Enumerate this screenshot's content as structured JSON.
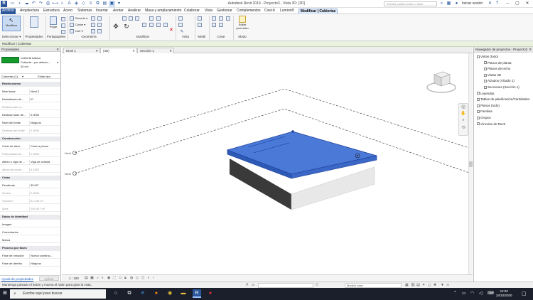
{
  "app": {
    "title": "Autodesk Revit 2019 - Proyecto3 - Vista 3D: {3D}",
    "search_placeholder": "Escriba palabra clave o frase",
    "sign_in": "Iniciar sesión"
  },
  "menu": {
    "items": [
      "Archivo",
      "Arquitectura",
      "Estructura",
      "Acero",
      "Sistemas",
      "Insertar",
      "Anotar",
      "Analizar",
      "Masa y emplazamiento",
      "Colaborar",
      "Vista",
      "Gestionar",
      "Complementos",
      "Cost-It",
      "Lumion®",
      "Modificar | Cubiertas"
    ]
  },
  "ribbon": {
    "modify_label": "Modificar",
    "select_label": "Seleccionar ▾",
    "properties_label": "Propiedades",
    "clipboard_label": "Portapapeles",
    "paste_label": "Pegar",
    "cope_label": "Recorte ▾",
    "cut_label": "Cortar ▾",
    "join_label": "Unir ▾",
    "geometry_label": "Geometría",
    "modify_panel_label": "Modificar",
    "view_label": "Vista",
    "measure_label": "Medir",
    "create_label": "Crear",
    "edit_perimeter_label": "Editar perímetro",
    "mode_label": "Modo"
  },
  "context_bar": "Modificar | Cubiertas",
  "properties": {
    "header": "Propiedades",
    "type_name_1": "Cubierta básica",
    "type_name_2": "Cubierta - por defecto -",
    "type_name_3": "30 cm",
    "selection": "Cubiertas (1)",
    "edit_type": "Editar tipo",
    "rows": [
      {
        "k": "Restricciones",
        "v": "",
        "group": true
      },
      {
        "k": "Nivel base",
        "v": "Nivel 2"
      },
      {
        "k": "Delimitación de...",
        "v": "☑"
      },
      {
        "k": "Relacionado co...",
        "v": "",
        "dim": true
      },
      {
        "k": "Desfase base de...",
        "v": "0.0000"
      },
      {
        "k": "Nivel del límite",
        "v": "Ninguno"
      },
      {
        "k": "Desfase del límite",
        "v": "0.0000",
        "dim": true
      },
      {
        "k": "Construcción",
        "v": "",
        "group": true
      },
      {
        "k": "Corte de alero",
        "v": "Corte a plomo"
      },
      {
        "k": "Profundidad de...",
        "v": "0.0000",
        "dim": true
      },
      {
        "k": "Altero o vigo de ...",
        "v": "Viga de celosía"
      },
      {
        "k": "Altura de comb...",
        "v": "6.4352",
        "dim": true
      },
      {
        "k": "Cotas",
        "v": "",
        "group": true
      },
      {
        "k": "Pendiente",
        "v": "30.00°"
      },
      {
        "k": "Grosor",
        "v": "0.3000",
        "dim": true
      },
      {
        "k": "Volumen",
        "v": "61.249 m³",
        "dim": true
      },
      {
        "k": "Área",
        "v": "204.497 m²",
        "dim": true
      },
      {
        "k": "Datos de identidad",
        "v": "",
        "group": true
      },
      {
        "k": "Imagen",
        "v": ""
      },
      {
        "k": "Comentarios",
        "v": ""
      },
      {
        "k": "Marca",
        "v": ""
      },
      {
        "k": "Proceso por fases",
        "v": "",
        "group": true
      },
      {
        "k": "Fase de creación",
        "v": "Nueva construc..."
      },
      {
        "k": "Fase de derribo",
        "v": "Ninguno"
      }
    ],
    "help_link": "Ayuda de propiedades",
    "apply": "Aplicar"
  },
  "tabs": [
    "Nivel 1",
    "{3D}",
    "Sección 1"
  ],
  "view": {
    "scale": "1 : 100",
    "level_tag": "Nivel"
  },
  "browser": {
    "header": "Navegador de proyectos - Proyecto3",
    "items": [
      {
        "t": "Vistas (todo)",
        "indent": 0
      },
      {
        "t": "Planos de planta",
        "indent": 1
      },
      {
        "t": "Planos de techo",
        "indent": 1
      },
      {
        "t": "Vistas 3D",
        "indent": 1
      },
      {
        "t": "Alzados (Alzado 1)",
        "indent": 1
      },
      {
        "t": "Secciones (Sección 1)",
        "indent": 1
      },
      {
        "t": "Leyendas",
        "indent": 0
      },
      {
        "t": "Tablas de planificación/Cantidades",
        "indent": 0
      },
      {
        "t": "Planos (todo)",
        "indent": 0
      },
      {
        "t": "Familias",
        "indent": 0
      },
      {
        "t": "Grupos",
        "indent": 0
      },
      {
        "t": "Vínculos de Revit",
        "indent": 0
      }
    ]
  },
  "status": {
    "message": "Mantenga pulsado el botón y mueva el ratón para girar la vista.",
    "model": "Modelo base",
    "zero": ":0"
  },
  "taskbar": {
    "search": "Escribe aquí para buscar",
    "time": "12:02",
    "date": "24/10/2020"
  },
  "colors": {
    "roof": "#3d6fd6",
    "accent": "#2b579a",
    "type_swatch": "#159a2c"
  }
}
